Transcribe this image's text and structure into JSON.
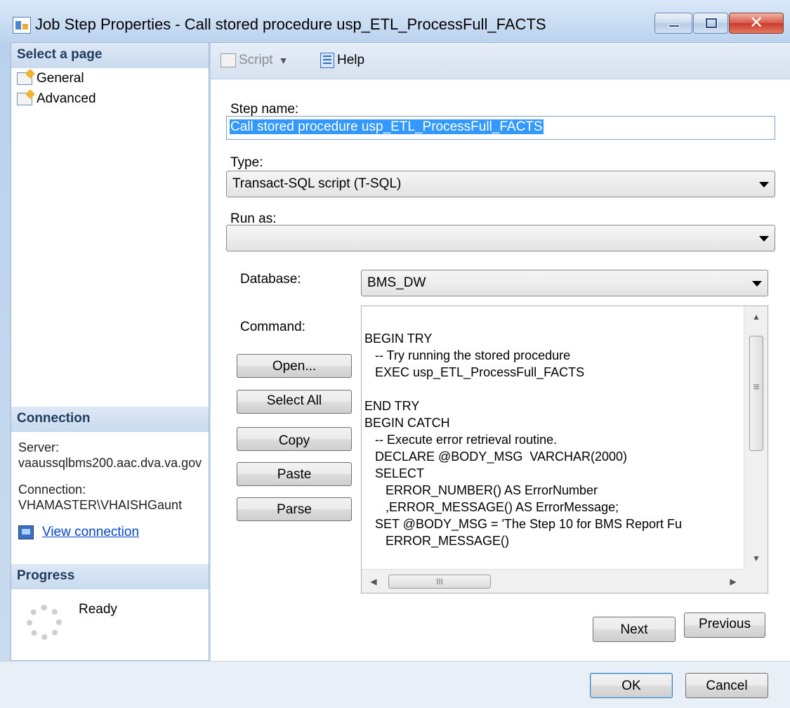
{
  "window": {
    "title": "Job Step Properties - Call stored procedure usp_ETL_ProcessFull_FACTS",
    "close_glyph": "✕"
  },
  "left_pane": {
    "select_page_header": "Select a page",
    "pages": [
      {
        "label": "General"
      },
      {
        "label": "Advanced"
      }
    ],
    "connection_header": "Connection",
    "server_label": "Server:",
    "server_value": "vaaussqlbms200.aac.dva.va.gov",
    "connection_label": "Connection:",
    "connection_value": "VHAMASTER\\VHAISHGaunt",
    "view_connection_link": "View connection",
    "progress_header": "Progress",
    "progress_status": "Ready"
  },
  "toolbar": {
    "script_label": "Script",
    "help_label": "Help"
  },
  "form": {
    "step_name_label": "Step name:",
    "step_name_value": "Call stored procedure usp_ETL_ProcessFull_FACTS",
    "type_label": "Type:",
    "type_value": "Transact-SQL script (T-SQL)",
    "run_as_label": "Run as:",
    "run_as_value": "",
    "database_label": "Database:",
    "database_value": "BMS_DW",
    "command_label": "Command:",
    "buttons": {
      "open": "Open...",
      "select_all": "Select All",
      "copy": "Copy",
      "paste": "Paste",
      "parse": "Parse"
    },
    "command_text": "BEGIN TRY\n   -- Try running the stored procedure\n   EXEC usp_ETL_ProcessFull_FACTS\n\nEND TRY\nBEGIN CATCH\n   -- Execute error retrieval routine.\n   DECLARE @BODY_MSG  VARCHAR(2000)\n   SELECT\n      ERROR_NUMBER() AS ErrorNumber\n      ,ERROR_MESSAGE() AS ErrorMessage;\n   SET @BODY_MSG = 'The Step 10 for BMS Report Fu\n      ERROR_MESSAGE()",
    "scroll_glyphs": {
      "up": "▲",
      "down": "▼",
      "left": "◀",
      "right": "▶",
      "vthumb_grip": "≡",
      "hthumb_grip": "III"
    },
    "next_label": "Next",
    "previous_label": "Previous"
  },
  "footer": {
    "ok_label": "OK",
    "cancel_label": "Cancel"
  }
}
